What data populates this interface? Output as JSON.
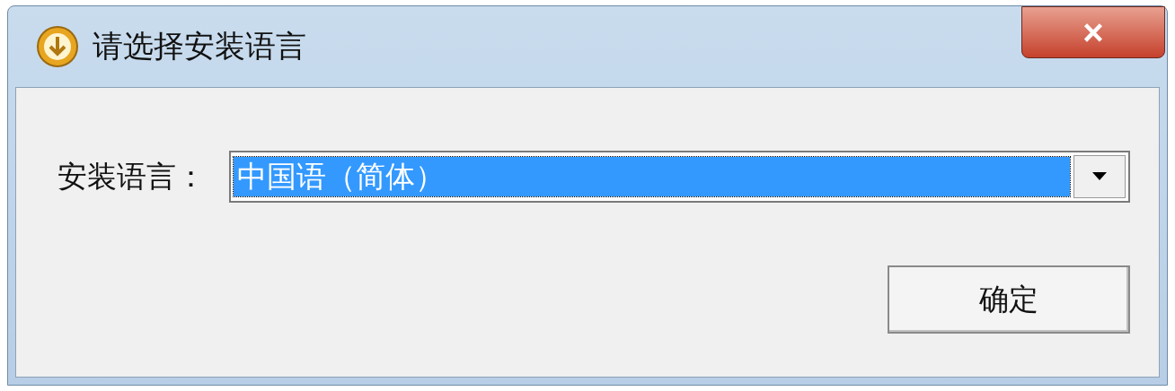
{
  "window": {
    "title": "请选择安装语言",
    "close_button": "×"
  },
  "language_field": {
    "label": "安装语言：",
    "value": "中国语（简体）",
    "selected": true
  },
  "buttons": [
    {
      "label": "确定"
    }
  ]
}
